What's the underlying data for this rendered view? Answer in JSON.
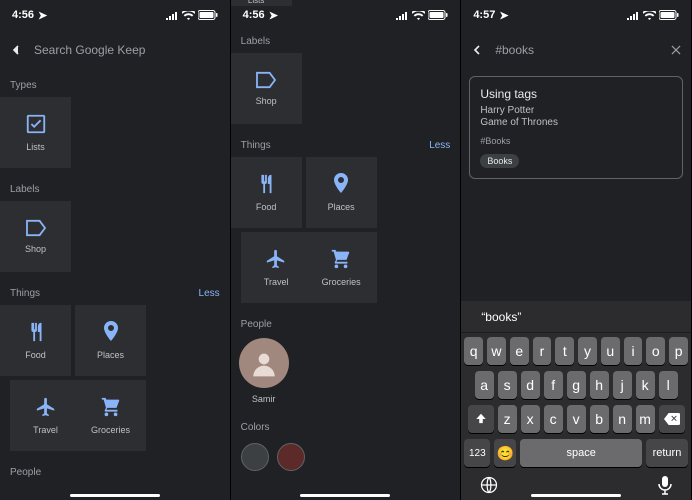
{
  "status": {
    "time1": "4:56",
    "time2": "4:56",
    "time3": "4:57"
  },
  "s1": {
    "search_placeholder": "Search Google Keep",
    "types_label": "Types",
    "lists_label": "Lists",
    "labels_label": "Labels",
    "shop_label": "Shop",
    "things_label": "Things",
    "less": "Less",
    "food": "Food",
    "places": "Places",
    "travel": "Travel",
    "groceries": "Groceries",
    "people_label": "People"
  },
  "s2": {
    "partial_lists": "Lists",
    "labels_label": "Labels",
    "shop_label": "Shop",
    "things_label": "Things",
    "less": "Less",
    "food": "Food",
    "places": "Places",
    "travel": "Travel",
    "groceries": "Groceries",
    "people_label": "People",
    "person": "Samir",
    "colors_label": "Colors",
    "swatches": [
      "#3c4043",
      "#5c2b29"
    ]
  },
  "s3": {
    "query": "#books",
    "note": {
      "title": "Using tags",
      "lines": [
        "Harry Potter",
        "Game of Thrones"
      ],
      "tag_text": "#Books",
      "chip": "Books"
    },
    "kb": {
      "suggestion": "“books”",
      "row1": [
        "q",
        "w",
        "e",
        "r",
        "t",
        "y",
        "u",
        "i",
        "o",
        "p"
      ],
      "row2": [
        "a",
        "s",
        "d",
        "f",
        "g",
        "h",
        "j",
        "k",
        "l"
      ],
      "row3": [
        "z",
        "x",
        "c",
        "v",
        "b",
        "n",
        "m"
      ],
      "num": "123",
      "space": "space",
      "return": "return"
    }
  }
}
